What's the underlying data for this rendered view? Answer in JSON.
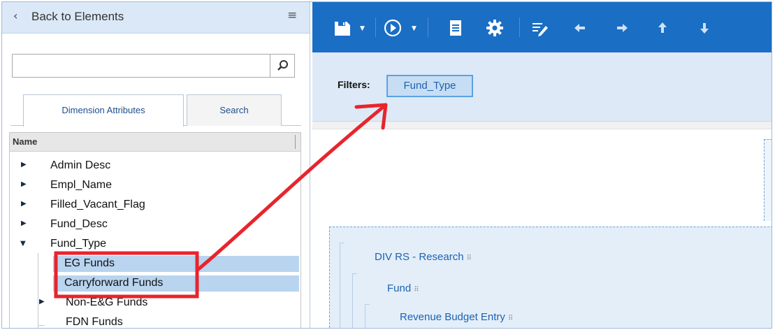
{
  "left_panel": {
    "back_label": "Back to Elements",
    "search": {
      "value": "",
      "placeholder": ""
    },
    "tabs": [
      {
        "label": "Dimension Attributes",
        "active": true
      },
      {
        "label": "Search",
        "active": false
      }
    ],
    "tree": {
      "header": "Name",
      "items": [
        {
          "label": "Admin Desc",
          "state": "collapsed"
        },
        {
          "label": "Empl_Name",
          "state": "collapsed"
        },
        {
          "label": "Filled_Vacant_Flag",
          "state": "collapsed"
        },
        {
          "label": "Fund_Desc",
          "state": "collapsed"
        },
        {
          "label": "Fund_Type",
          "state": "expanded"
        },
        {
          "label": "EG Funds",
          "state": "leaf",
          "selected": true
        },
        {
          "label": "Carryforward Funds",
          "state": "leaf",
          "selected": true
        },
        {
          "label": "Non-E&G Funds",
          "state": "collapsed"
        },
        {
          "label": "FDN Funds",
          "state": "leaf"
        }
      ]
    }
  },
  "toolbar": {
    "icons": [
      "save-icon",
      "run-icon",
      "document-icon",
      "settings-icon",
      "edit-icon",
      "arrow-left-icon",
      "arrow-right-icon",
      "arrow-up-icon",
      "arrow-down-icon"
    ],
    "color": "#1a6ec4"
  },
  "filters": {
    "label": "Filters:",
    "chips": [
      "Fund_Type"
    ]
  },
  "report_design": {
    "dimensions": [
      "DIV RS - Research",
      "Fund",
      "Revenue Budget Entry"
    ]
  },
  "annotation": {
    "color": "#e8242c"
  }
}
